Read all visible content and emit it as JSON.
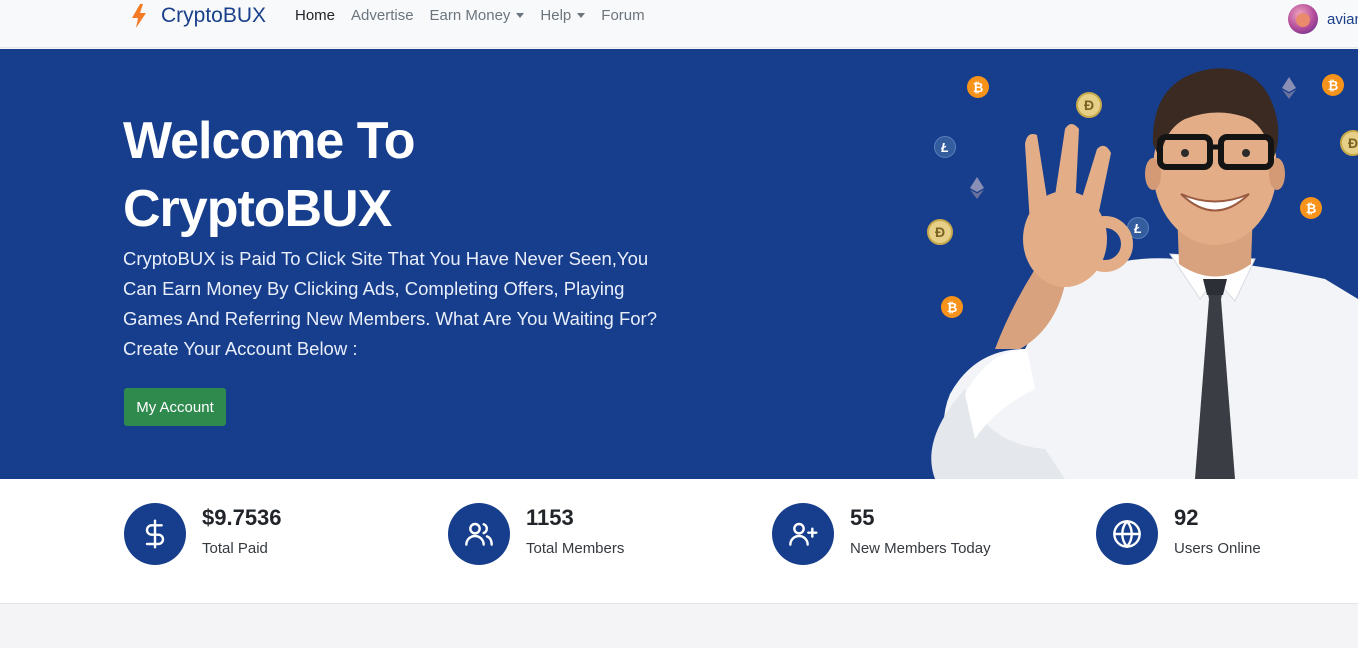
{
  "navbar": {
    "brand": "CryptoBUX",
    "links": [
      {
        "label": "Home"
      },
      {
        "label": "Advertise"
      },
      {
        "label": "Earn Money"
      },
      {
        "label": "Help"
      },
      {
        "label": "Forum"
      }
    ],
    "user_name": "avian"
  },
  "hero": {
    "title_line1": "Welcome To",
    "title_line2": "CryptoBUX",
    "description": "CryptoBUX is Paid To Click Site That You Have Never Seen,You Can Earn Money By Clicking Ads, Completing Offers, Playing Games And Referring New Members. What Are You Waiting For? Create Your Account Below :",
    "button_label": "My Account"
  },
  "stats": [
    {
      "value": "$9.7536",
      "label": "Total Paid",
      "icon": "dollar-icon"
    },
    {
      "value": "1153",
      "label": "Total Members",
      "icon": "users-icon"
    },
    {
      "value": "55",
      "label": "New Members Today",
      "icon": "user-plus-icon"
    },
    {
      "value": "92",
      "label": "Users Online",
      "icon": "globe-icon"
    }
  ],
  "colors": {
    "primary": "#163e8c",
    "button": "#2f8a4d",
    "brand_accent": "#f57c26",
    "bitcoin": "#f7931a"
  }
}
